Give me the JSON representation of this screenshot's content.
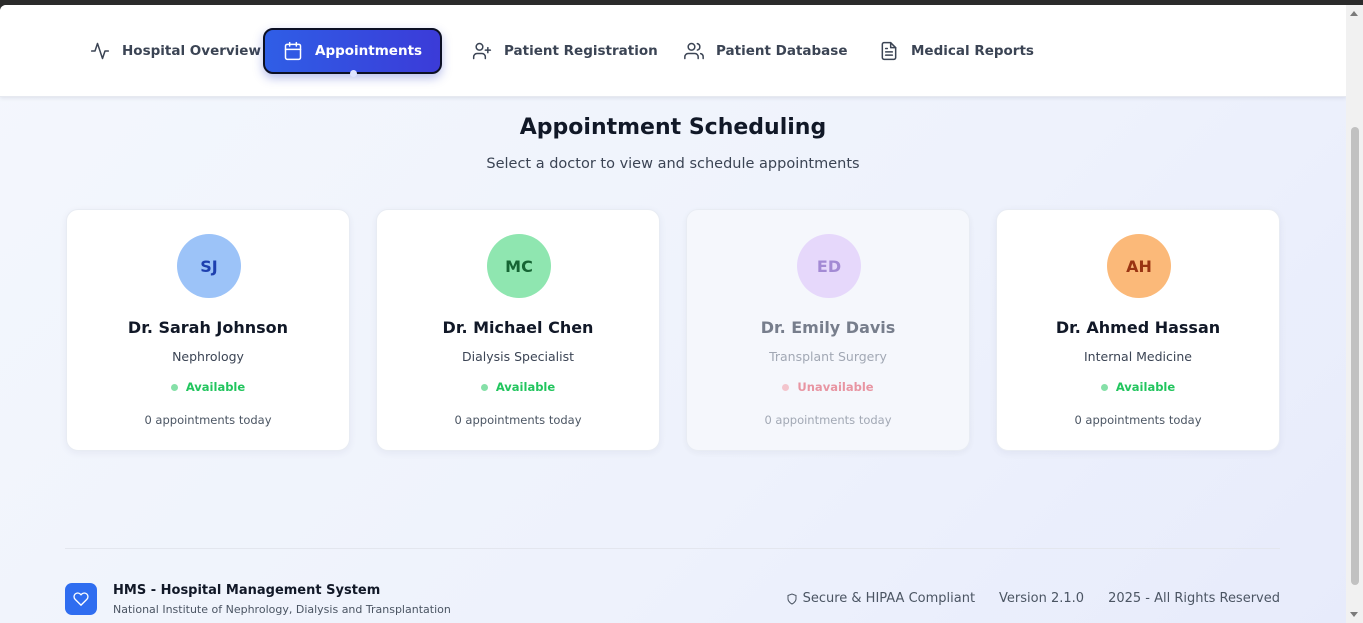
{
  "nav": {
    "tabs": [
      {
        "label": "Hospital Overview",
        "icon": "activity-icon"
      },
      {
        "label": "Appointments",
        "icon": "calendar-icon",
        "active": true
      },
      {
        "label": "Patient Registration",
        "icon": "user-plus-icon"
      },
      {
        "label": "Patient Database",
        "icon": "users-icon"
      },
      {
        "label": "Medical Reports",
        "icon": "file-text-icon"
      }
    ]
  },
  "main": {
    "title": "Appointment Scheduling",
    "subtitle": "Select a doctor to view and schedule appointments"
  },
  "doctors": [
    {
      "initials": "SJ",
      "name": "Dr. Sarah Johnson",
      "specialty": "Nephrology",
      "status": "Available",
      "count": "0 appointments today",
      "avatar_bg": "#9cc3f8",
      "avatar_fg": "#1e40af"
    },
    {
      "initials": "MC",
      "name": "Dr. Michael Chen",
      "specialty": "Dialysis Specialist",
      "status": "Available",
      "count": "0 appointments today",
      "avatar_bg": "#8fe6b0",
      "avatar_fg": "#166534"
    },
    {
      "initials": "ED",
      "name": "Dr. Emily Davis",
      "specialty": "Transplant Surgery",
      "status": "Unavailable",
      "count": "0 appointments today",
      "avatar_bg": "#e6d6fb",
      "avatar_fg": "#9b7fd0"
    },
    {
      "initials": "AH",
      "name": "Dr. Ahmed Hassan",
      "specialty": "Internal Medicine",
      "status": "Available",
      "count": "0 appointments today",
      "avatar_bg": "#fbb979",
      "avatar_fg": "#9a3412"
    }
  ],
  "status_colors": {
    "available": "#22c55e",
    "unavailable": "#f0a3ad"
  },
  "footer": {
    "title": "HMS - Hospital Management System",
    "subtitle": "National Institute of Nephrology, Dialysis and Transplantation",
    "secure": "Secure & HIPAA Compliant",
    "version": "Version 2.1.0",
    "copyright": "2025 - All Rights Reserved",
    "logo_icon": "heart-icon",
    "secure_icon": "shield-icon"
  }
}
